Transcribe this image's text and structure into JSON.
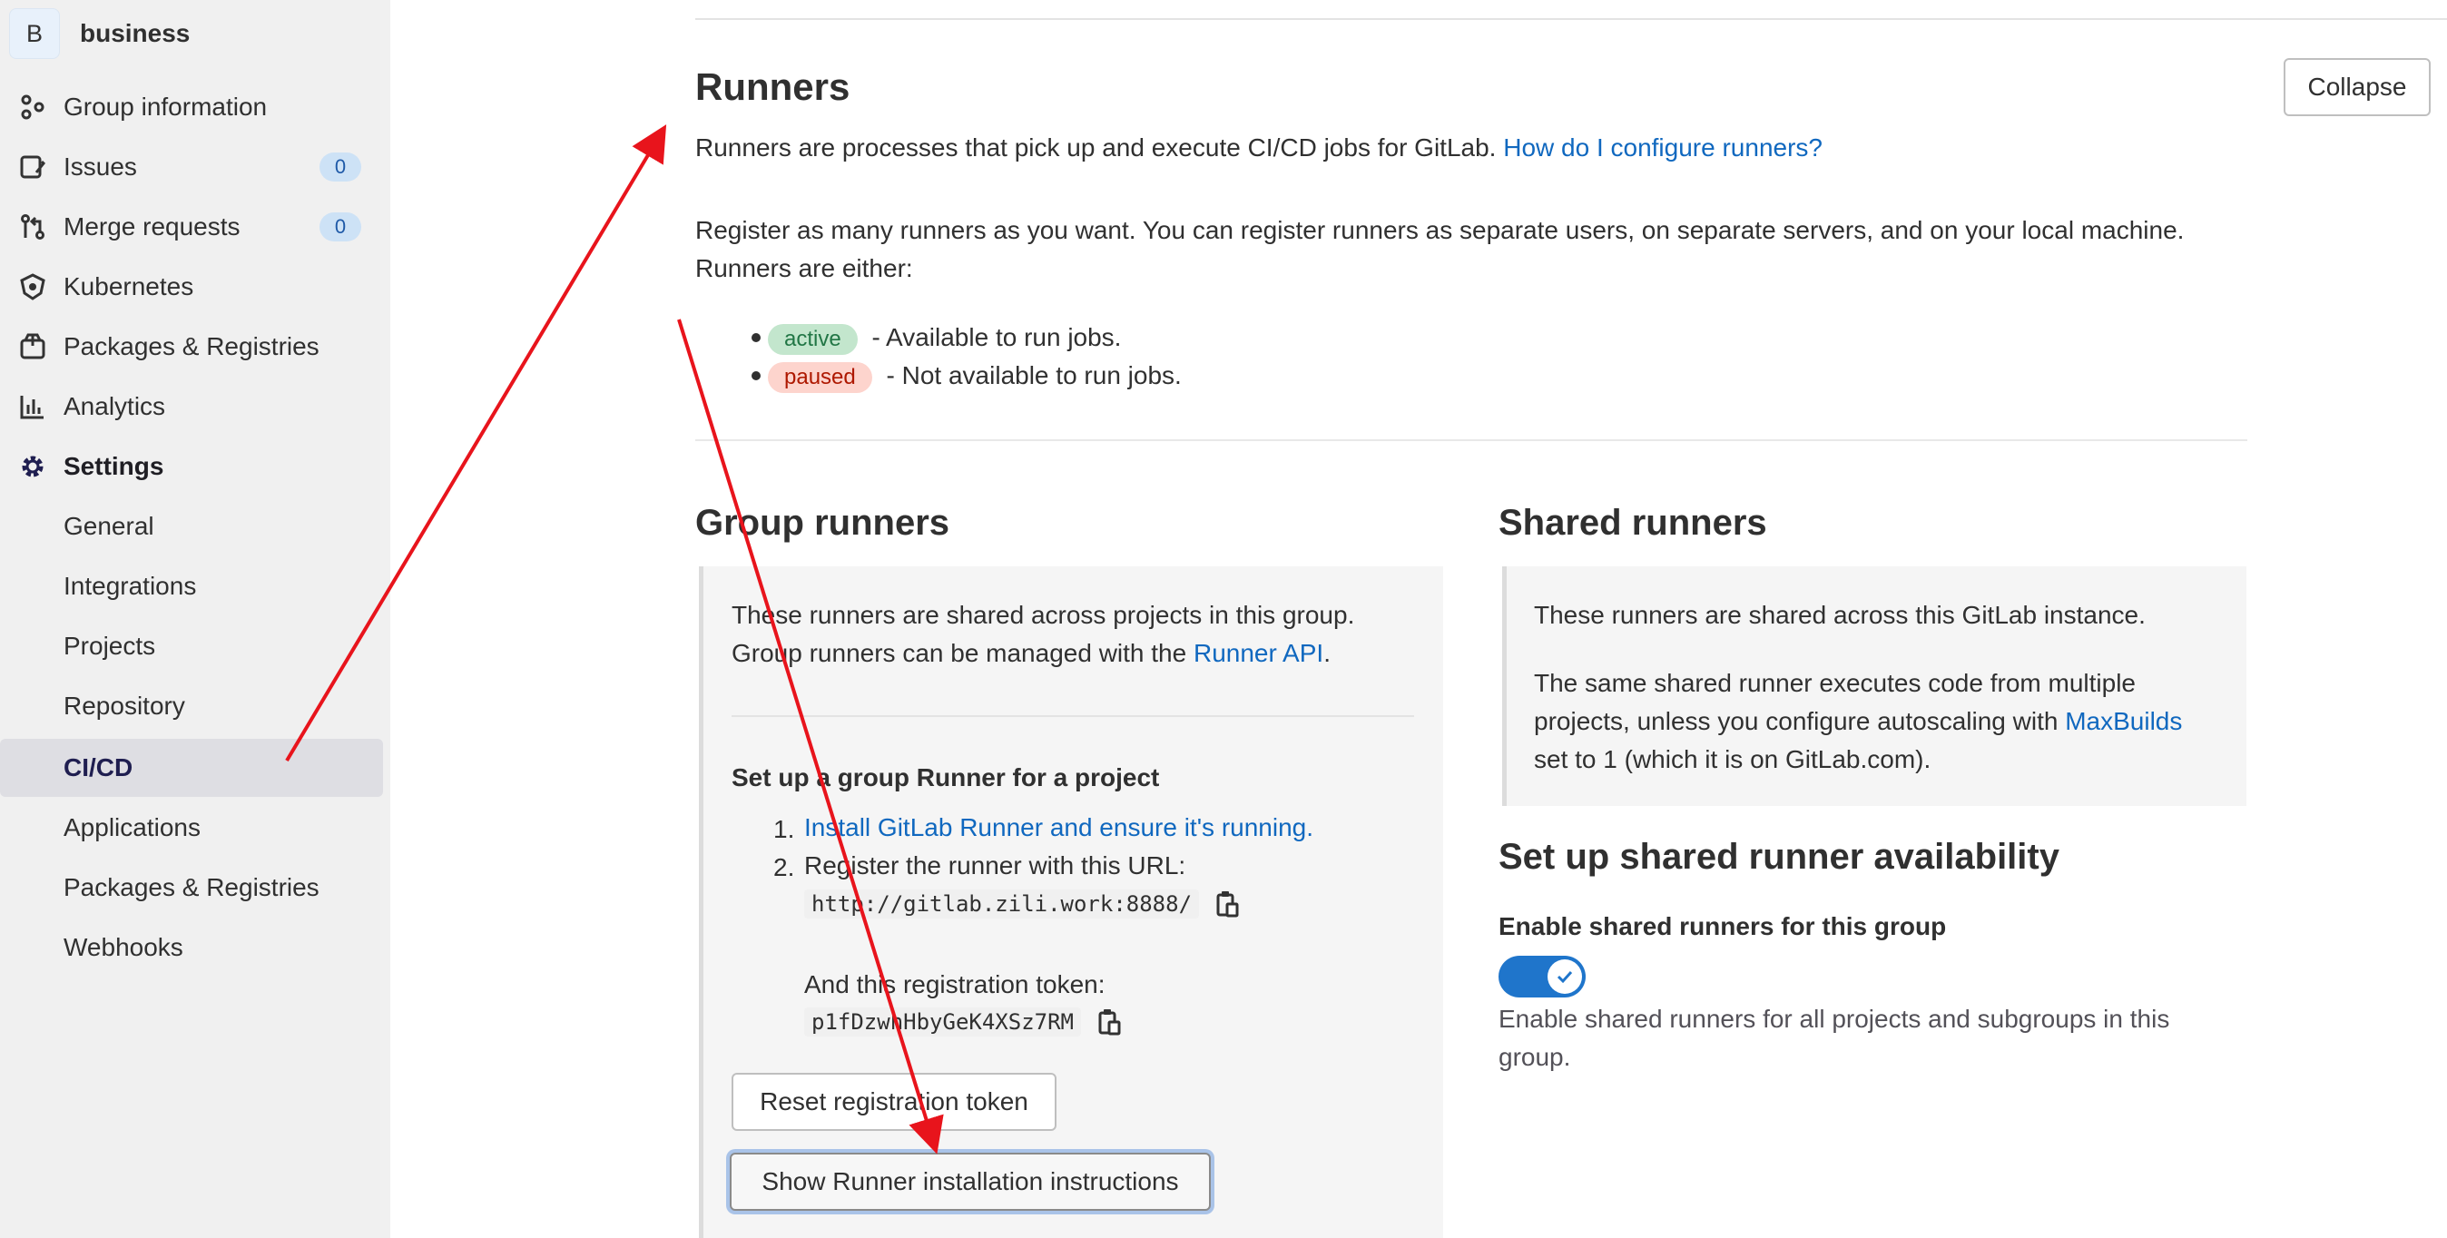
{
  "sidebar": {
    "avatar_letter": "B",
    "group_name": "business",
    "items": [
      {
        "label": "Group information",
        "icon": "group-icon"
      },
      {
        "label": "Issues",
        "icon": "issues-icon",
        "count": "0"
      },
      {
        "label": "Merge requests",
        "icon": "merge-request-icon",
        "count": "0"
      },
      {
        "label": "Kubernetes",
        "icon": "kubernetes-icon"
      },
      {
        "label": "Packages & Registries",
        "icon": "package-icon"
      },
      {
        "label": "Analytics",
        "icon": "analytics-icon"
      },
      {
        "label": "Settings",
        "icon": "settings-gear-icon"
      }
    ],
    "settings_sub": [
      {
        "label": "General"
      },
      {
        "label": "Integrations"
      },
      {
        "label": "Projects"
      },
      {
        "label": "Repository"
      },
      {
        "label": "CI/CD",
        "selected": true
      },
      {
        "label": "Applications"
      },
      {
        "label": "Packages & Registries"
      },
      {
        "label": "Webhooks"
      }
    ]
  },
  "runners": {
    "title": "Runners",
    "collapse_label": "Collapse",
    "intro": "Runners are processes that pick up and execute CI/CD jobs for GitLab.",
    "intro_link": "How do I configure runners?",
    "register_line1": "Register as many runners as you want. You can register runners as separate users, on separate servers, and on your local machine.",
    "register_line2": "Runners are either:",
    "active_badge": "active",
    "active_desc": " - Available to run jobs.",
    "paused_badge": "paused",
    "paused_desc": " - Not available to run jobs."
  },
  "group_runners": {
    "title": "Group runners",
    "desc_line1": "These runners are shared across projects in this group.",
    "desc_line2_prefix": "Group runners can be managed with the ",
    "desc_line2_link": "Runner API",
    "desc_line2_suffix": ".",
    "setup_title": "Set up a group Runner for a project",
    "step1_num": "1.",
    "step1_link": "Install GitLab Runner and ensure it's running.",
    "step2_num": "2.",
    "step2_text": "Register the runner with this URL:",
    "url": "http://gitlab.zili.work:8888/",
    "token_label": "And this registration token:",
    "token": "p1fDzwhHbyGeK4XSz7RM",
    "reset_label": "Reset registration token",
    "show_label": "Show Runner installation instructions"
  },
  "shared_runners": {
    "title": "Shared runners",
    "desc1": "These runners are shared across this GitLab instance.",
    "desc2_line1": "The same shared runner executes code from multiple",
    "desc2_line2_prefix": "projects, unless you configure autoscaling with ",
    "desc2_line2_link": "MaxBuilds",
    "desc2_line3": "set to 1 (which it is on GitLab.com).",
    "availability_title": "Set up shared runner availability",
    "enable_label": "Enable shared runners for this group",
    "toggle_on": true,
    "enable_help_line1": "Enable shared runners for all projects and subgroups in this",
    "enable_help_line2": "group."
  },
  "colors": {
    "link": "#1068bf",
    "toggle": "#1f75cb",
    "annotation_arrow": "#e8141c"
  }
}
